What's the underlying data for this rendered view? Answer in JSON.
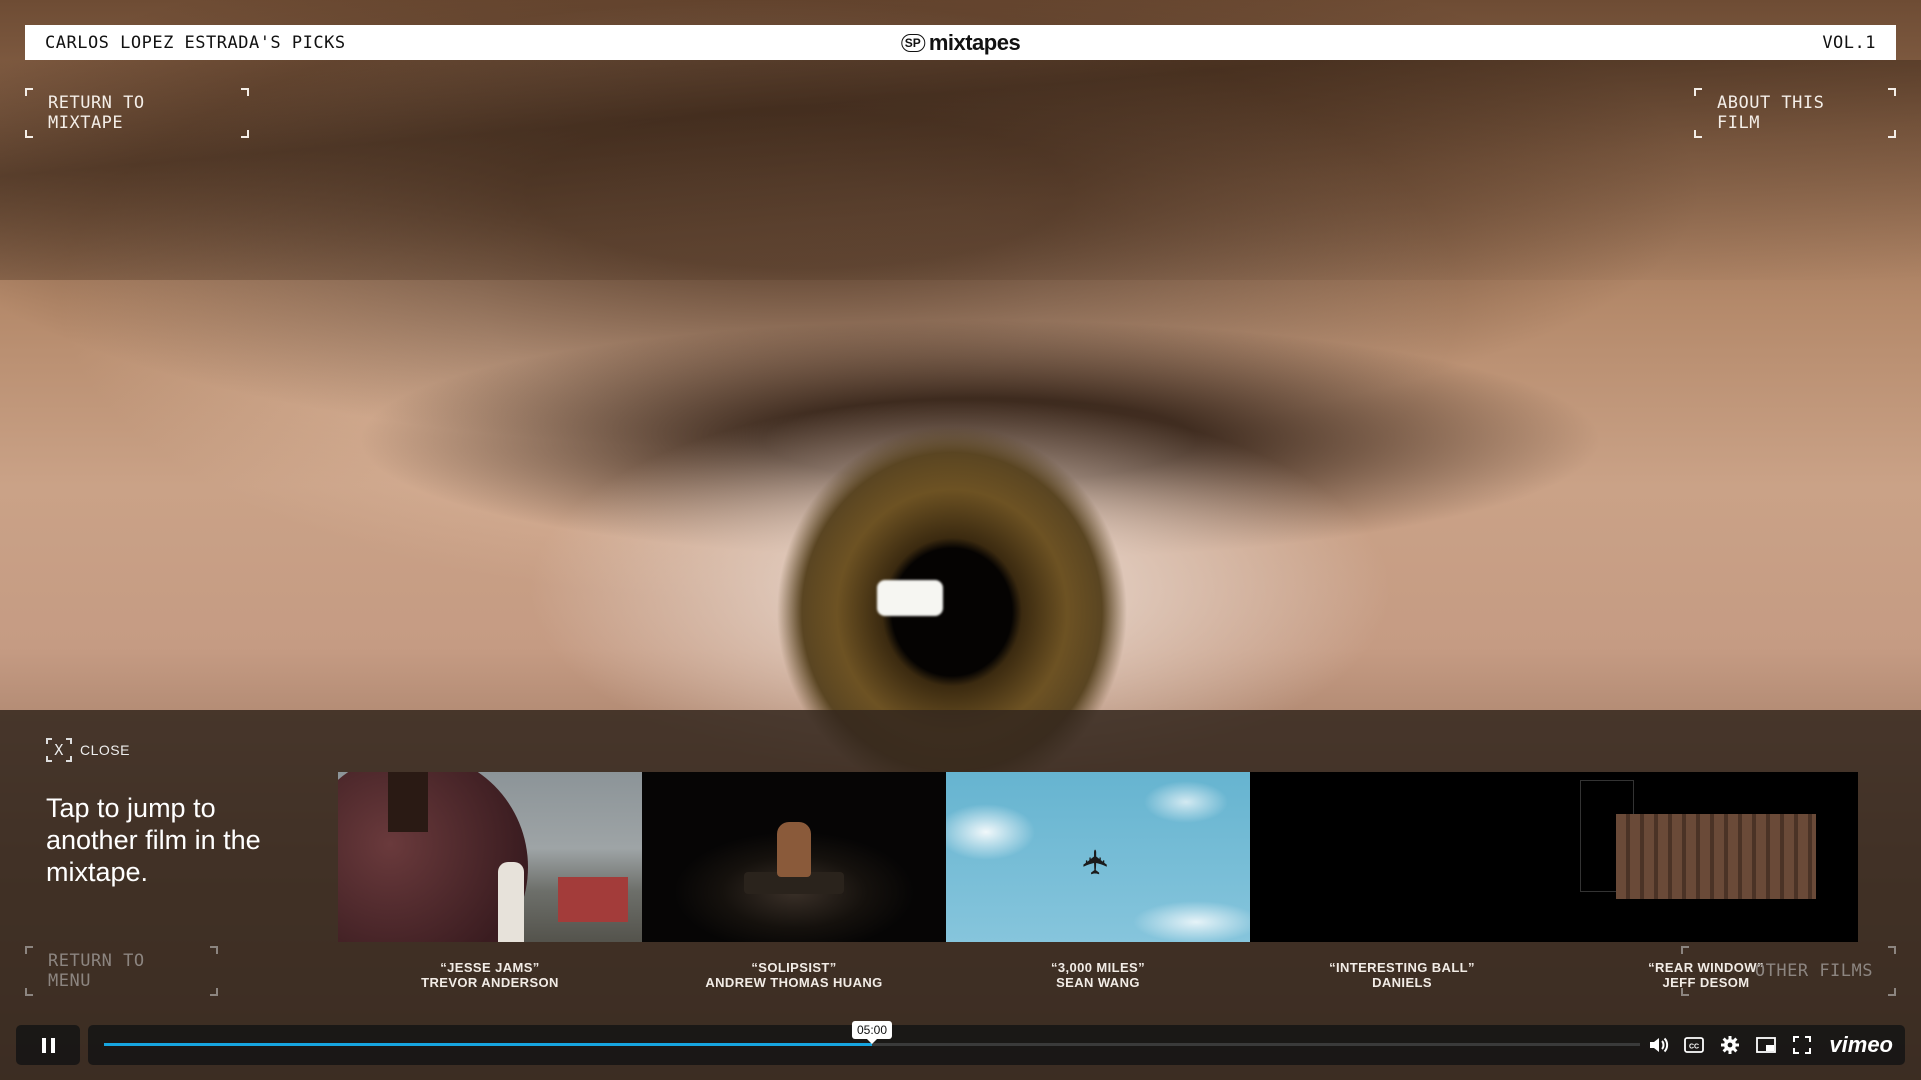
{
  "header": {
    "left_text": "CARLOS LOPEZ ESTRADA'S PICKS",
    "brand_mark": "SP",
    "brand_name": "mixtapes",
    "right_text": "VOL.1"
  },
  "nav": {
    "return_mixtape": "RETURN TO MIXTAPE",
    "about_film": "ABOUT THIS FILM",
    "return_menu": "RETURN TO MENU",
    "other_films": "OTHER FILMS"
  },
  "jump_panel": {
    "close_x": "X",
    "close_label": "CLOSE",
    "title": "Tap to jump to another film in the mixtape.",
    "films": [
      {
        "title": "“JESSE JAMS”",
        "director": "TREVOR ANDERSON"
      },
      {
        "title": "“SOLIPSIST”",
        "director": "ANDREW THOMAS HUANG"
      },
      {
        "title": "“3,000 MILES”",
        "director": "SEAN WANG"
      },
      {
        "title": "“INTERESTING BALL”",
        "director": "DANIELS"
      },
      {
        "title": "“REAR WINDOW”",
        "director": "JEFF DESOM"
      }
    ]
  },
  "player": {
    "time_tooltip": "05:00",
    "progress_fraction": 0.5,
    "brand": "vimeo",
    "icons": [
      "pause-icon",
      "volume-icon",
      "closed-captions-icon",
      "settings-icon",
      "picture-in-picture-icon",
      "fullscreen-icon"
    ],
    "accent_color": "#17a5e0"
  }
}
